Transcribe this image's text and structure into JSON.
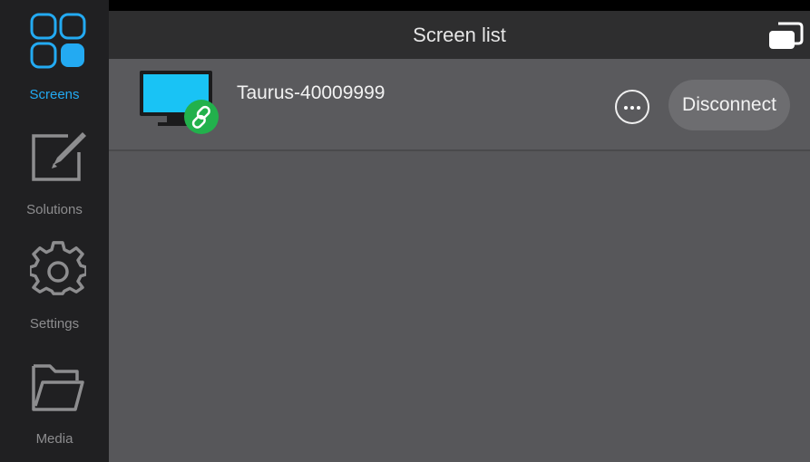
{
  "sidebar": {
    "items": [
      {
        "label": "Screens",
        "icon": "screens-grid-icon",
        "active": true
      },
      {
        "label": "Solutions",
        "icon": "edit-pencil-icon",
        "active": false
      },
      {
        "label": "Settings",
        "icon": "gear-icon",
        "active": false
      },
      {
        "label": "Media",
        "icon": "folder-icon",
        "active": false
      }
    ]
  },
  "header": {
    "title": "Screen list",
    "action_icon": "screens-switch-icon"
  },
  "screens": [
    {
      "name": "Taurus-40009999",
      "status": "connected",
      "status_icon": "link-icon",
      "more_icon": "more-dots-icon",
      "action_label": "Disconnect"
    }
  ],
  "colors": {
    "accent": "#23aaf2",
    "connected": "#22b14c",
    "sidebar_bg": "#202022",
    "header_bg": "#2e2e2f",
    "content_bg": "#57575a"
  }
}
